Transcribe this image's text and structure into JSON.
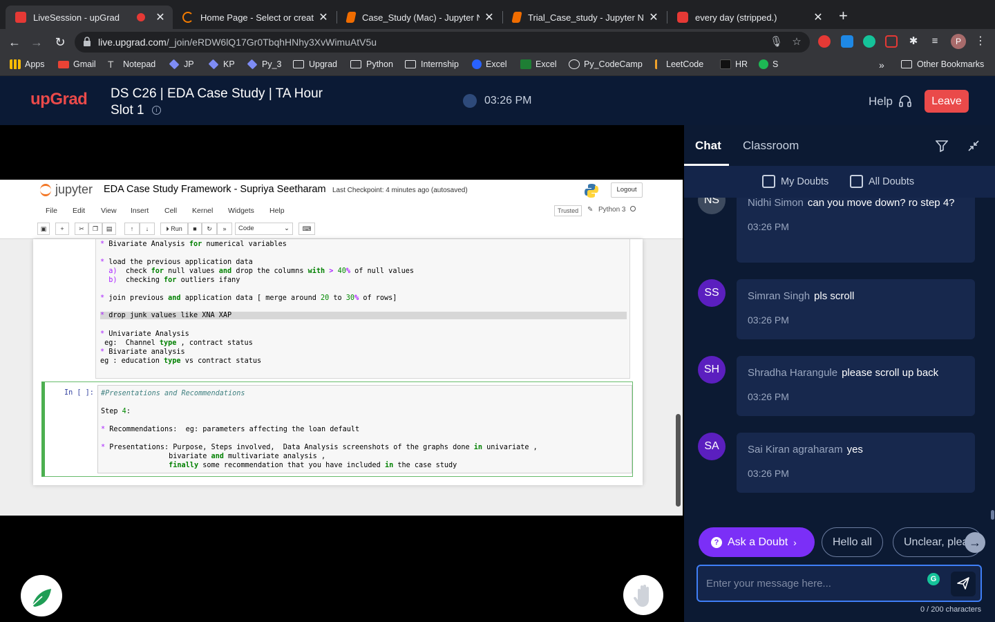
{
  "browser": {
    "tabs": [
      {
        "label": "LiveSession - upGrad",
        "color": "#e53935",
        "active": true
      },
      {
        "label": "Home Page - Select or create a",
        "color": "#f57c00",
        "active": false
      },
      {
        "label": "Case_Study (Mac) - Jupyter Nc",
        "color": "#ef6c00",
        "active": false
      },
      {
        "label": "Trial_Case_study - Jupyter Not",
        "color": "#ef6c00",
        "active": false
      },
      {
        "label": "every day (stripped.)",
        "color": "#e53935",
        "active": false
      }
    ],
    "url_host": "live.upgrad.com",
    "url_path": "/_join/eRDW6lQ17Gr0TbqhHNhy3XvWimuAtV5u",
    "profile_initial": "P",
    "bookmarks": [
      {
        "label": "Apps",
        "icon": "apps-grid-icon",
        "color": "#e8eaed"
      },
      {
        "label": "Gmail",
        "icon": "gmail-icon",
        "color": "#ea4335"
      },
      {
        "label": "Notepad",
        "icon": "notepad-icon",
        "color": "#cfcfcf"
      },
      {
        "label": "JP",
        "icon": "diamond-icon",
        "color": "#7e8cf5"
      },
      {
        "label": "KP",
        "icon": "diamond-icon",
        "color": "#7e8cf5"
      },
      {
        "label": "Py_3",
        "icon": "diamond-icon",
        "color": "#7e8cf5"
      },
      {
        "label": "Upgrad",
        "icon": "folder-icon",
        "color": "#e8eaed"
      },
      {
        "label": "Python",
        "icon": "folder-icon",
        "color": "#e8eaed"
      },
      {
        "label": "Internship",
        "icon": "folder-icon",
        "color": "#e8eaed"
      },
      {
        "label": "Excel",
        "icon": "c-icon",
        "color": "#2962ff"
      },
      {
        "label": "Excel",
        "icon": "excel-icon",
        "color": "#1e7e34"
      },
      {
        "label": "Py_CodeCamp",
        "icon": "code-camp-icon",
        "color": "#e8eaed"
      },
      {
        "label": "LeetCode",
        "icon": "leetcode-icon",
        "color": "#f0a22b"
      },
      {
        "label": "HR",
        "icon": "hackerrank-icon",
        "color": "#111"
      },
      {
        "label": "S",
        "icon": "spotify-icon",
        "color": "#1db954"
      }
    ],
    "more_bookmarks": "»",
    "other_bookmarks": "Other Bookmarks"
  },
  "header": {
    "logo": "upGrad",
    "session_title": "DS C26 | EDA Case Study | TA Hour Slot 1",
    "clock": "03:26 PM",
    "help": "Help",
    "leave": "Leave",
    "accent": "#ea4a4a"
  },
  "jupyter": {
    "brand": "jupyter",
    "notebook_name": "EDA Case Study Framework - Supriya Seetharam",
    "checkpoint": "Last Checkpoint: 4 minutes ago  (autosaved)",
    "logout": "Logout",
    "menu": [
      "File",
      "Edit",
      "View",
      "Insert",
      "Cell",
      "Kernel",
      "Widgets",
      "Help"
    ],
    "trusted": "Trusted",
    "kernel": "Python 3",
    "run": "Run",
    "cell_type": "Code",
    "cell2_prompt": "In [ ]:"
  },
  "chat": {
    "tabs": [
      "Chat",
      "Classroom"
    ],
    "filters": [
      "My Doubts",
      "All Doubts"
    ],
    "messages": [
      {
        "initials": "NS",
        "name": "Nidhi Simon",
        "text": "can you move down? ro step 4?",
        "time": "03:26 PM",
        "color": "#3d4a5e"
      },
      {
        "initials": "SS",
        "name": "Simran Singh",
        "text": "pls scroll",
        "time": "03:26 PM",
        "color": "#5b1fbf"
      },
      {
        "initials": "SH",
        "name": "Shradha Harangule",
        "text": "please scroll up back",
        "time": "03:26 PM",
        "color": "#5b1fbf"
      },
      {
        "initials": "SA",
        "name": "Sai Kiran agraharam",
        "text": "yes",
        "time": "03:26 PM",
        "color": "#5b1fbf"
      }
    ],
    "ask_doubt": "Ask a Doubt",
    "quick_replies": [
      "Hello all",
      "Unclear, please"
    ],
    "input_placeholder": "Enter your message here...",
    "char_count": "0 / 200 characters"
  }
}
